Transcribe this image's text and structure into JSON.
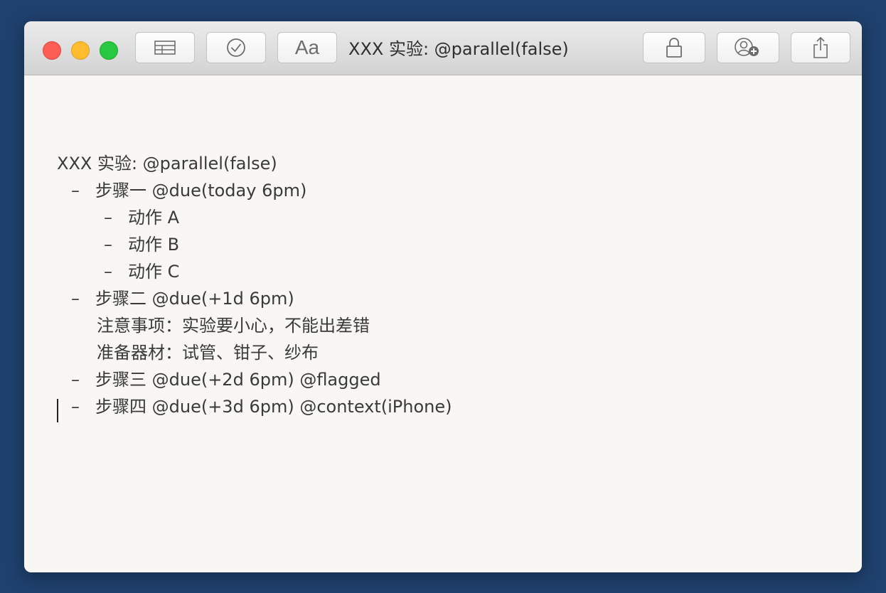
{
  "window": {
    "title": "XXX 实验: @parallel(false)"
  },
  "toolbar": {
    "buttons": [
      {
        "name": "table-view",
        "icon": "table-icon"
      },
      {
        "name": "check",
        "icon": "checkmark-circle-icon"
      },
      {
        "name": "font",
        "icon": "font-icon",
        "glyph": "Aa"
      },
      {
        "name": "lock",
        "icon": "lock-icon"
      },
      {
        "name": "share-person",
        "icon": "add-person-icon"
      },
      {
        "name": "share",
        "icon": "share-icon"
      }
    ]
  },
  "document": {
    "lines": [
      {
        "indent": 0,
        "bullet": "",
        "text": "XXX 实验: @parallel(false)"
      },
      {
        "indent": 1,
        "bullet": "–",
        "text": "步骤一 @due(today 6pm)"
      },
      {
        "indent": 2,
        "bullet": "–",
        "text": "动作 A"
      },
      {
        "indent": 2,
        "bullet": "–",
        "text": "动作 B"
      },
      {
        "indent": 2,
        "bullet": "–",
        "text": "动作 C"
      },
      {
        "indent": 1,
        "bullet": "–",
        "text": "步骤二 @due(+1d 6pm)"
      },
      {
        "indent": 1,
        "bullet": "",
        "text": "注意事项：实验要小心，不能出差错"
      },
      {
        "indent": 1,
        "bullet": "",
        "text": "准备器材：试管、钳子、纱布"
      },
      {
        "indent": 1,
        "bullet": "–",
        "text": "步骤三 @due(+2d 6pm) @flagged"
      },
      {
        "indent": 1,
        "bullet": "–",
        "text": "步骤四 @due(+3d 6pm) @context(iPhone)"
      }
    ]
  },
  "colors": {
    "desktop": "#1f416e",
    "close": "#fd5f57",
    "minimize": "#febc2e",
    "maximize": "#28c840",
    "text": "#3a3a3a"
  }
}
